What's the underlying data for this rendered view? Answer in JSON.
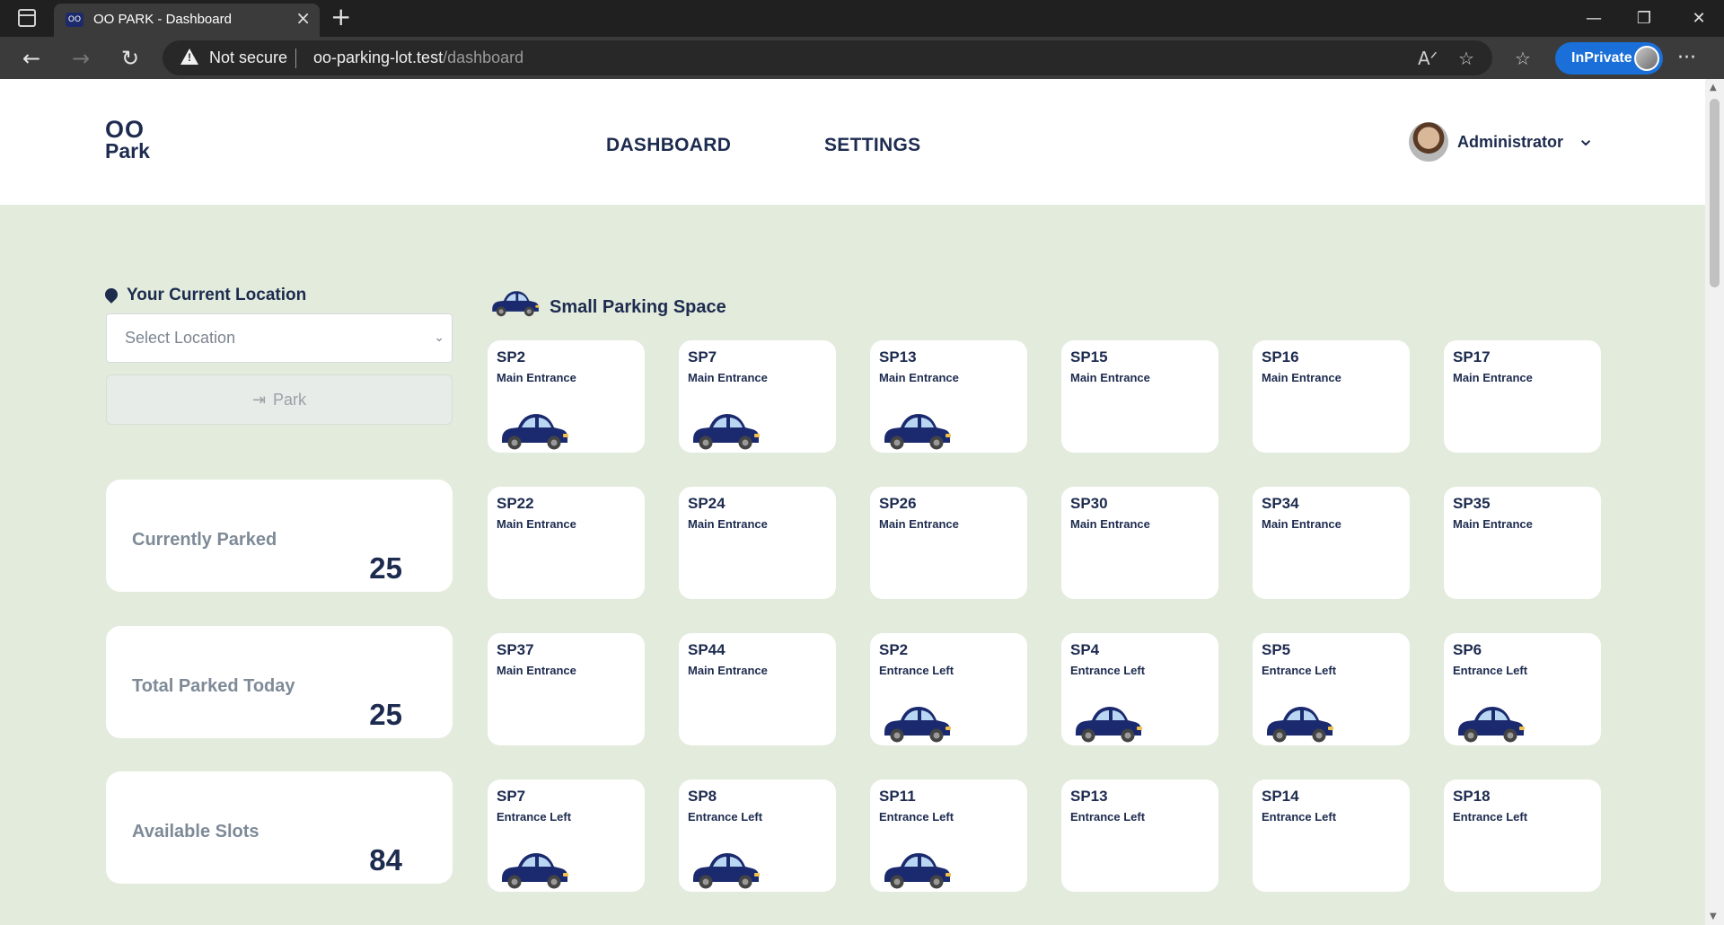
{
  "browser": {
    "tab_title": "OO PARK - Dashboard",
    "tab_favicon_text": "OO",
    "security_label": "Not secure",
    "url_host": "oo-parking-lot.test",
    "url_path": "/dashboard",
    "inprivate_label": "InPrivate"
  },
  "header": {
    "logo_line1": "OO",
    "logo_line2": "Park",
    "nav": [
      {
        "label": "DASHBOARD"
      },
      {
        "label": "SETTINGS"
      }
    ],
    "user_name": "Administrator"
  },
  "location": {
    "label": "Your Current Location",
    "select_placeholder": "Select Location",
    "park_button": "Park"
  },
  "stats": [
    {
      "label": "Currently Parked",
      "value": "25"
    },
    {
      "label": "Total Parked Today",
      "value": "25"
    },
    {
      "label": "Available Slots",
      "value": "84"
    }
  ],
  "section_title": "Small Parking Space",
  "colors": {
    "accent": "#1d2b4f",
    "car_body": "#1b2a6e",
    "page_bg": "#e2ebdc",
    "inprivate": "#1a6fd8"
  },
  "slots": [
    {
      "code": "SP2",
      "location": "Main Entrance",
      "occupied": true
    },
    {
      "code": "SP7",
      "location": "Main Entrance",
      "occupied": true
    },
    {
      "code": "SP13",
      "location": "Main Entrance",
      "occupied": true
    },
    {
      "code": "SP15",
      "location": "Main Entrance",
      "occupied": false
    },
    {
      "code": "SP16",
      "location": "Main Entrance",
      "occupied": false
    },
    {
      "code": "SP17",
      "location": "Main Entrance",
      "occupied": false
    },
    {
      "code": "SP22",
      "location": "Main Entrance",
      "occupied": false
    },
    {
      "code": "SP24",
      "location": "Main Entrance",
      "occupied": false
    },
    {
      "code": "SP26",
      "location": "Main Entrance",
      "occupied": false
    },
    {
      "code": "SP30",
      "location": "Main Entrance",
      "occupied": false
    },
    {
      "code": "SP34",
      "location": "Main Entrance",
      "occupied": false
    },
    {
      "code": "SP35",
      "location": "Main Entrance",
      "occupied": false
    },
    {
      "code": "SP37",
      "location": "Main Entrance",
      "occupied": false
    },
    {
      "code": "SP44",
      "location": "Main Entrance",
      "occupied": false
    },
    {
      "code": "SP2",
      "location": "Entrance Left",
      "occupied": true
    },
    {
      "code": "SP4",
      "location": "Entrance Left",
      "occupied": true
    },
    {
      "code": "SP5",
      "location": "Entrance Left",
      "occupied": true
    },
    {
      "code": "SP6",
      "location": "Entrance Left",
      "occupied": true
    },
    {
      "code": "SP7",
      "location": "Entrance Left",
      "occupied": true
    },
    {
      "code": "SP8",
      "location": "Entrance Left",
      "occupied": true
    },
    {
      "code": "SP11",
      "location": "Entrance Left",
      "occupied": true
    },
    {
      "code": "SP13",
      "location": "Entrance Left",
      "occupied": false
    },
    {
      "code": "SP14",
      "location": "Entrance Left",
      "occupied": false
    },
    {
      "code": "SP18",
      "location": "Entrance Left",
      "occupied": false
    }
  ]
}
